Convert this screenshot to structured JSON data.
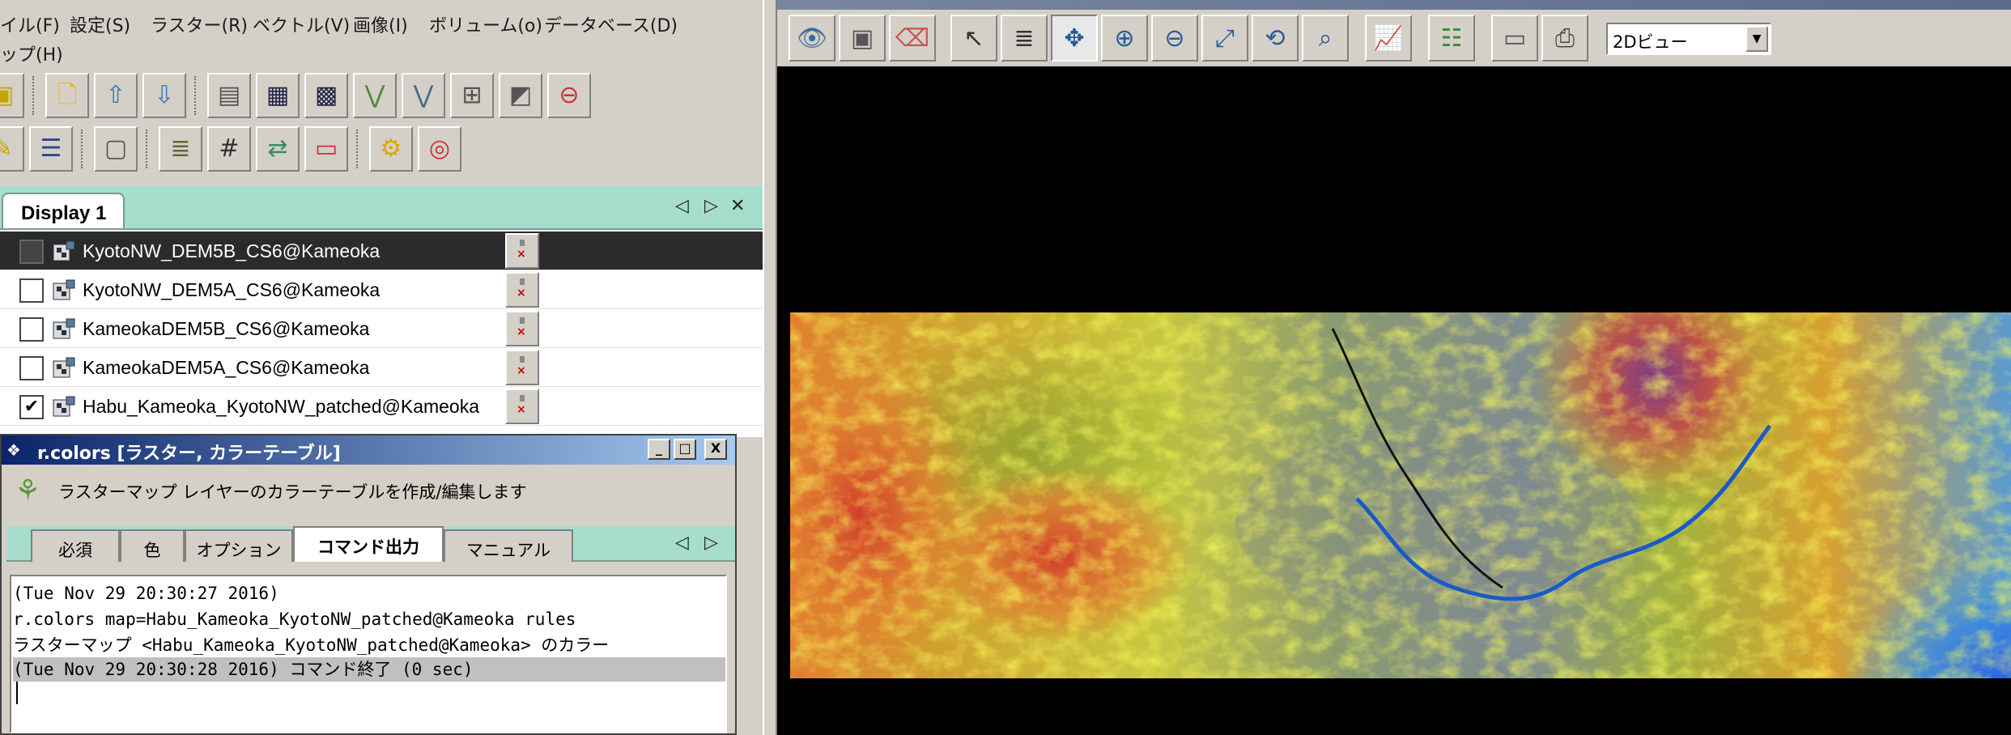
{
  "menubar": {
    "items": [
      "イル(F)",
      "設定(S)",
      "ラスター(R)",
      "ベクトル(V)",
      "画像(I)",
      "ボリューム(o)",
      "データベース(D)"
    ],
    "help": "ップ(H)"
  },
  "display_tab": {
    "label": "Display 1"
  },
  "layers": [
    {
      "name": "KyotoNW_DEM5B_CS6@Kameoka",
      "checked": false,
      "selected": true
    },
    {
      "name": "KyotoNW_DEM5A_CS6@Kameoka",
      "checked": false,
      "selected": false
    },
    {
      "name": "KameokaDEM5B_CS6@Kameoka",
      "checked": false,
      "selected": false
    },
    {
      "name": "KameokaDEM5A_CS6@Kameoka",
      "checked": false,
      "selected": false
    },
    {
      "name": "Habu_Kameoka_KyotoNW_patched@Kameoka",
      "checked": true,
      "selected": false
    }
  ],
  "dialog": {
    "title": "r.colors [ラスター, カラーテーブル]",
    "description": "ラスターマップ レイヤーのカラーテーブルを作成/編集します",
    "tabs": [
      "必須",
      "色",
      "オプション",
      "コマンド出力",
      "マニュアル"
    ],
    "active_tab": "コマンド出力",
    "output_lines": [
      "(Tue Nov 29 20:30:27 2016)",
      "r.colors map=Habu_Kameoka_KyotoNW_patched@Kameoka rules",
      "ラスターマップ <Habu_Kameoka_KyotoNW_patched@Kameoka> のカラー",
      "(Tue Nov 29 20:30:28 2016) コマンド終了 (0 sec)"
    ],
    "window_buttons": [
      "_",
      "□",
      "X"
    ]
  },
  "map_toolbar": {
    "view_mode": "2Dビュー",
    "tools": [
      "display-map",
      "render-map",
      "erase",
      "pointer",
      "query",
      "pan",
      "zoom-in",
      "zoom-out",
      "zoom-extent",
      "zoom-back",
      "zoom-options",
      "analyze",
      "overlay",
      "save-display",
      "print"
    ]
  },
  "colors": {
    "tab_area": "#a6ddcd",
    "title_gradient_start": "#0a246a",
    "title_gradient_end": "#a6caf0",
    "map_background": "#000000"
  }
}
